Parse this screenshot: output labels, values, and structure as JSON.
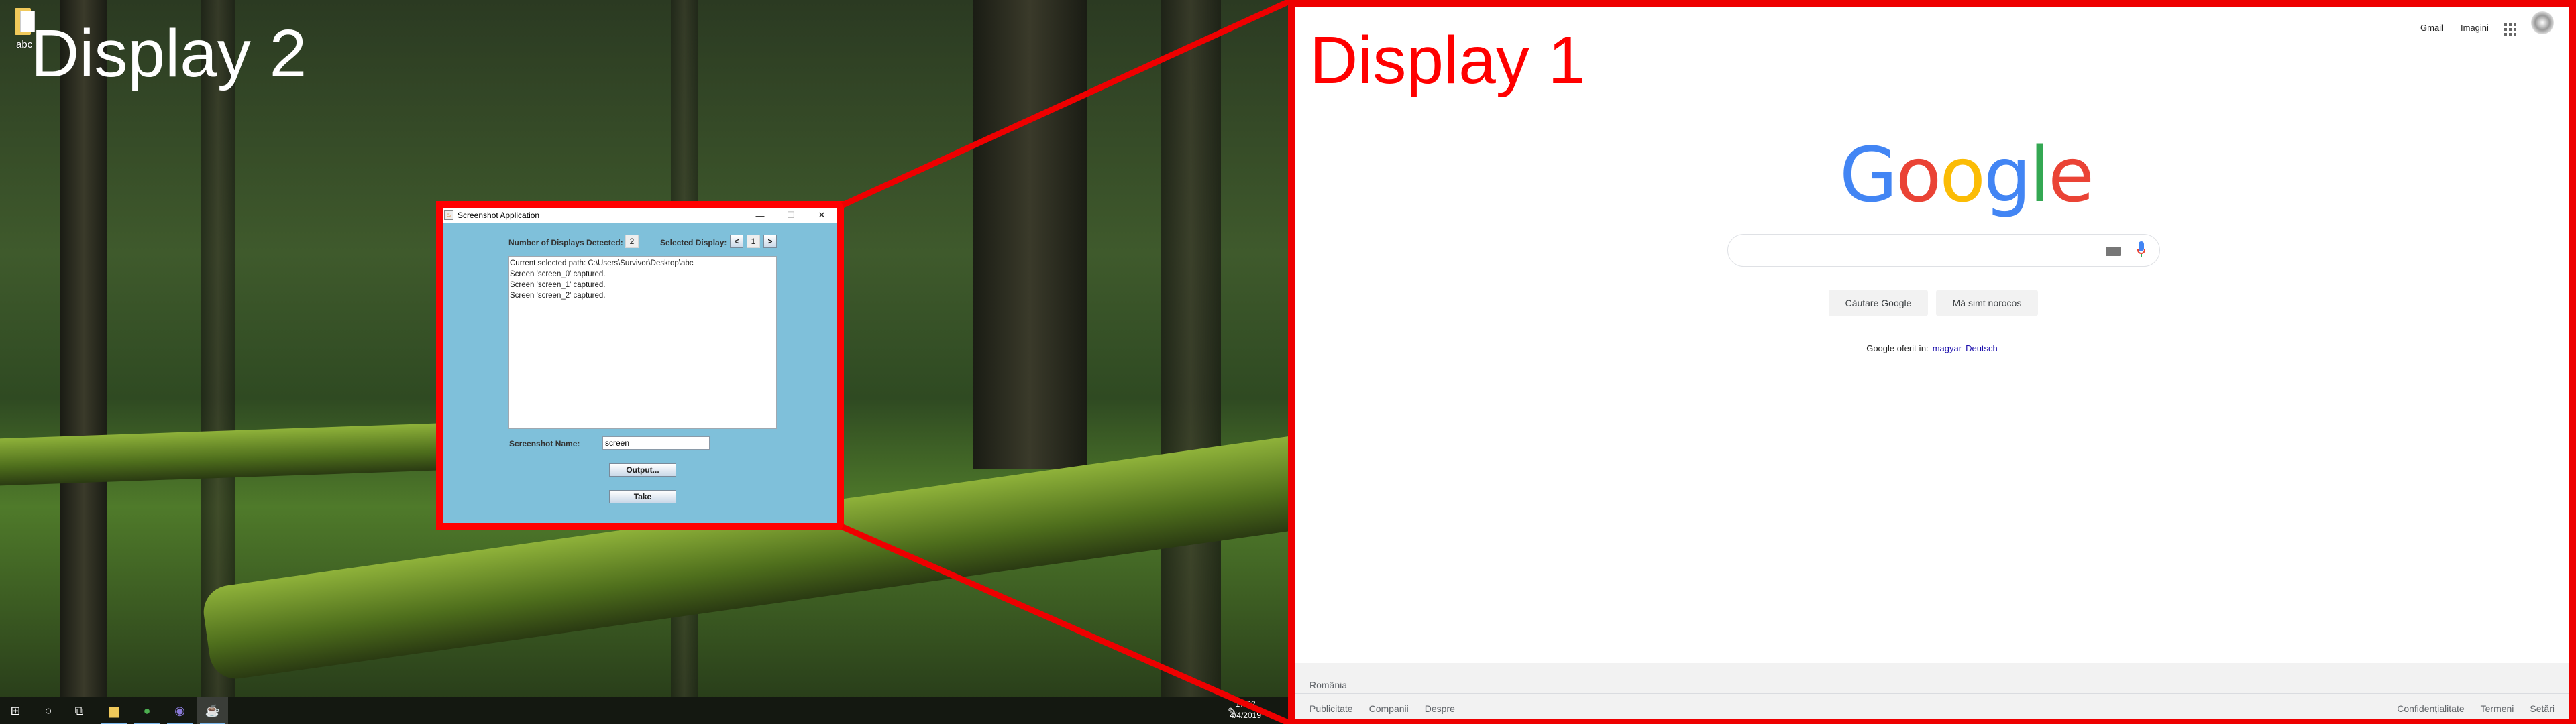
{
  "display2": {
    "label": "Display 2",
    "desktop_icon": {
      "label": "abc",
      "icon": "folder-icon"
    },
    "taskbar": {
      "items": [
        {
          "name": "start",
          "icon": "windows-icon",
          "glyph": "⊞"
        },
        {
          "name": "search",
          "icon": "cortana-icon",
          "glyph": "○"
        },
        {
          "name": "task-view",
          "icon": "task-view-icon",
          "glyph": "⧉"
        },
        {
          "name": "file-explorer",
          "icon": "folder-icon",
          "glyph": "▆"
        },
        {
          "name": "chrome",
          "icon": "chrome-icon",
          "glyph": "●"
        },
        {
          "name": "eclipse",
          "icon": "eclipse-icon",
          "glyph": "◉"
        },
        {
          "name": "java-app",
          "icon": "java-icon",
          "glyph": "☕"
        }
      ],
      "time": "17:02",
      "date": "4/4/2019"
    }
  },
  "app": {
    "title": "Screenshot Application",
    "displays_label": "Number of Displays Detected:",
    "displays_count": "2",
    "selected_label": "Selected Display:",
    "prev": "<",
    "selected": "1",
    "next": ">",
    "log": [
      "Current selected path: C:\\Users\\Survivor\\Desktop\\abc",
      "Screen 'screen_0' captured.",
      "Screen 'screen_1' captured.",
      "Screen 'screen_2' captured."
    ],
    "name_label": "Screenshot Name:",
    "name_value": "screen",
    "output_button": "Output...",
    "take_button": "Take",
    "min": "—",
    "max": "☐",
    "close": "✕"
  },
  "display1": {
    "label": "Display 1",
    "gmail": "Gmail",
    "images": "Imagini",
    "logo": "Google",
    "search_button": "Căutare Google",
    "lucky_button": "Mă simt norocos",
    "offered_in": "Google oferit în:",
    "lang1": "magyar",
    "lang2": "Deutsch",
    "country": "România",
    "footer_left": [
      "Publicitate",
      "Companii",
      "Despre"
    ],
    "footer_right": [
      "Confidențialitate",
      "Termeni",
      "Setări"
    ]
  },
  "colors": {
    "highlight": "#ff0000",
    "app_bg": "#7fc0da",
    "google_blue": "#4285f4",
    "google_red": "#ea4335",
    "google_yellow": "#fbbc05",
    "google_green": "#34a853"
  }
}
